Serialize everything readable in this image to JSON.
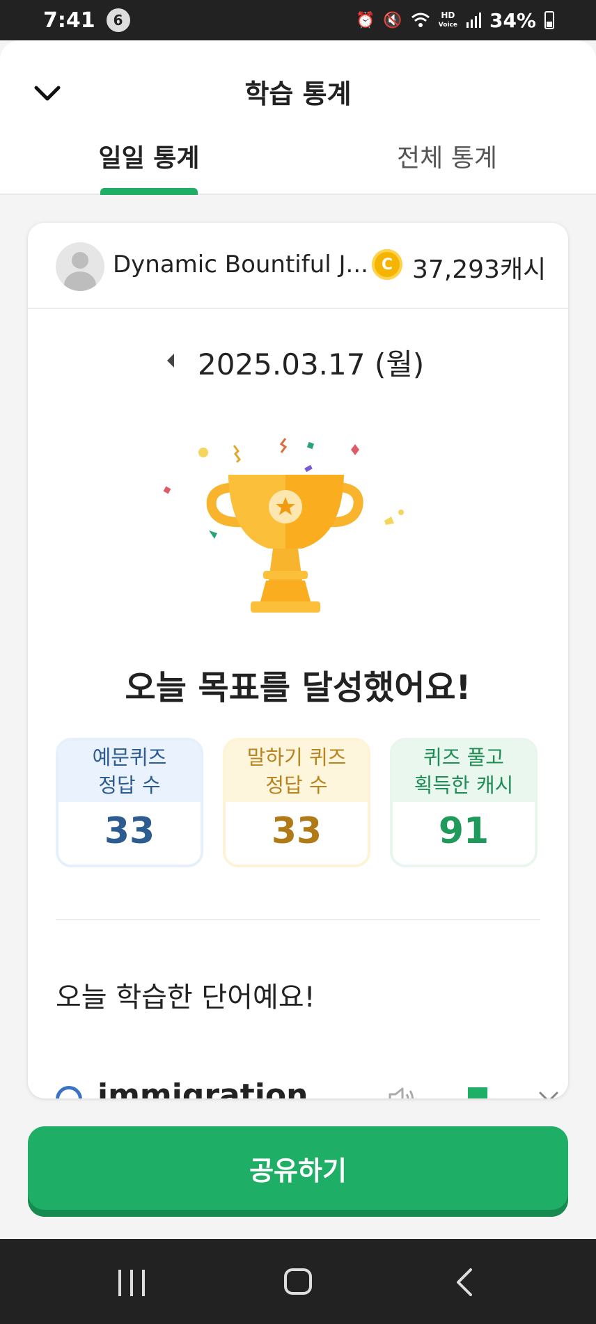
{
  "status_bar": {
    "time": "7:41",
    "notification_count": "6",
    "hd_label": "HD",
    "voice_label": "Voice",
    "battery": "34%"
  },
  "header": {
    "title": "학습 통계",
    "tabs": [
      {
        "label": "일일 통계",
        "active": true
      },
      {
        "label": "전체 통계",
        "active": false
      }
    ]
  },
  "user": {
    "name": "Dynamic Bountiful J...",
    "coin_symbol": "C",
    "cash": "37,293캐시"
  },
  "date": "2025.03.17 (월)",
  "goal_message": "오늘 목표를 달성했어요!",
  "stats": [
    {
      "label_line1": "예문퀴즈",
      "label_line2": "정답 수",
      "value": "33",
      "color": "#2d5c91"
    },
    {
      "label_line1": "말하기 퀴즈",
      "label_line2": "정답 수",
      "value": "33",
      "color": "#b07a16"
    },
    {
      "label_line1": "퀴즈 풀고",
      "label_line2": "획득한 캐시",
      "value": "91",
      "color": "#1f9a5b"
    }
  ],
  "words_title": "오늘 학습한 단어예요!",
  "words": [
    {
      "word": "immigration"
    }
  ],
  "share_button": "공유하기",
  "accent_color": "#1fae66"
}
